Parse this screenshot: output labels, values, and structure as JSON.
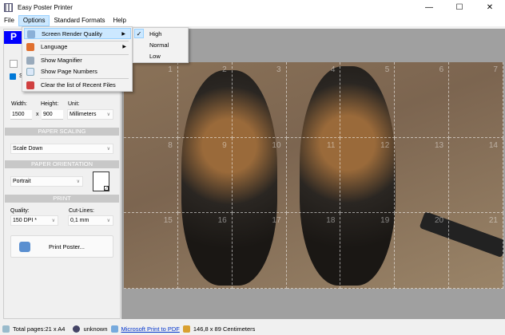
{
  "window": {
    "title": "Easy Poster Printer",
    "minimize": "—",
    "maximize": "☐",
    "close": "✕"
  },
  "menubar": [
    "File",
    "Options",
    "Standard Formats",
    "Help"
  ],
  "options_menu": [
    {
      "label": "Screen Render Quality",
      "icon": "render-quality-icon",
      "submenu": true
    },
    {
      "label": "Language",
      "icon": "language-icon",
      "submenu": true
    },
    {
      "label": "Show Magnifier",
      "icon": "magnifier-icon"
    },
    {
      "label": "Show Page Numbers",
      "icon": "page-numbers-icon"
    },
    {
      "label": "Clear the list of Recent Files",
      "icon": "clear-recent-icon"
    }
  ],
  "quality_submenu": {
    "items": [
      "High",
      "Normal",
      "Low"
    ],
    "checked": "High",
    "check": "✓"
  },
  "left_panel": {
    "header": "P",
    "checkbox_label": "S",
    "width_label": "Width:",
    "height_label": "Height:",
    "unit_label": "Unit:",
    "width": "1500",
    "times": "x",
    "height": "900",
    "unit": "Millimeters",
    "scaling_header": "PAPER SCALING",
    "scaling": "Scale Down",
    "orientation_header": "PAPER ORIENTATION",
    "orientation": "Portrait",
    "print_header": "PRINT",
    "quality_label": "Quality:",
    "quality": "150 DPI *",
    "cutlines_label": "Cut-Lines:",
    "cutlines": "0,1 mm",
    "print_button": "Print Poster..."
  },
  "page_numbers": [
    "1",
    "2",
    "3",
    "4",
    "5",
    "6",
    "7",
    "8",
    "9",
    "10",
    "11",
    "12",
    "13",
    "14",
    "15",
    "16",
    "17",
    "18",
    "19",
    "20",
    "21"
  ],
  "status": {
    "pages": "Total pages:21 x A4",
    "unknown": "unknown",
    "printer": "Microsoft Print to PDF",
    "size": "146,8 x 89 Centimeters"
  }
}
